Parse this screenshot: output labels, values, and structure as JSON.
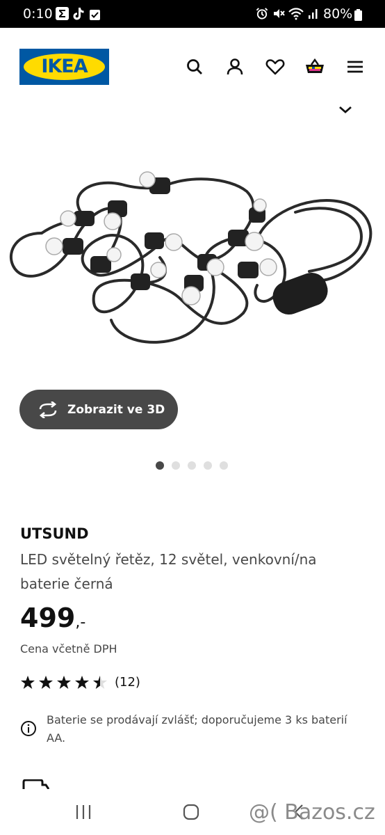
{
  "status_bar": {
    "time": "0:10",
    "battery": "80%",
    "icons": [
      "sigma-icon",
      "tiktok-icon",
      "check-box-icon",
      "alarm-icon",
      "mute-icon",
      "wifi-icon",
      "signal-icon",
      "battery-icon"
    ]
  },
  "header": {
    "logo_text": "IKEA",
    "logo_colors": {
      "blue": "#0058a3",
      "yellow": "#ffdb00"
    },
    "actions": [
      "search-icon",
      "profile-icon",
      "favorites-heart-icon",
      "shopping-basket-icon",
      "menu-icon"
    ]
  },
  "product": {
    "view_3d_label": "Zobrazit ve 3D",
    "carousel": {
      "count": 5,
      "active_index": 0
    },
    "name": "UTSUND",
    "description": "LED světelný řetěz, 12 světel, venkovní/na baterie černá",
    "price": "499",
    "price_suffix": ",-",
    "price_note": "Cena včetně DPH",
    "rating": {
      "value": 4.5,
      "max": 5,
      "reviews": "(12)"
    },
    "battery_note": "Baterie se prodávají zvlášť; doporučujeme 3 ks baterií AA."
  },
  "navigation_bar": {
    "icons": [
      "recent-apps-icon",
      "home-icon",
      "back-icon"
    ]
  },
  "watermark": "@( Bazos.cz"
}
